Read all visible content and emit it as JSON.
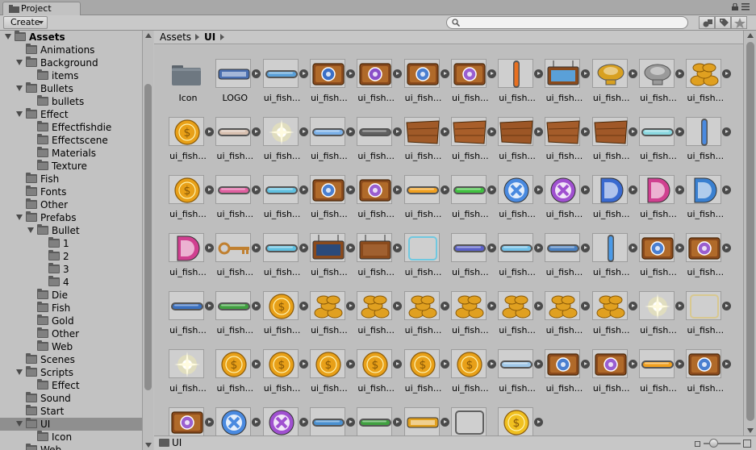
{
  "window": {
    "tab_title": "Project"
  },
  "toolbar": {
    "create_label": "Create",
    "search_value": "",
    "search_placeholder": ""
  },
  "breadcrumb": [
    "Assets",
    "UI"
  ],
  "tree": [
    {
      "label": "Assets",
      "depth": 0,
      "expanded": true,
      "bold": true
    },
    {
      "label": "Animations",
      "depth": 1,
      "expanded": null
    },
    {
      "label": "Background",
      "depth": 1,
      "expanded": true
    },
    {
      "label": "items",
      "depth": 2,
      "expanded": null
    },
    {
      "label": "Bullets",
      "depth": 1,
      "expanded": true
    },
    {
      "label": "bullets",
      "depth": 2,
      "expanded": null
    },
    {
      "label": "Effect",
      "depth": 1,
      "expanded": true
    },
    {
      "label": "Effectfishdie",
      "depth": 2,
      "expanded": null
    },
    {
      "label": "Effectscene",
      "depth": 2,
      "expanded": null
    },
    {
      "label": "Materials",
      "depth": 2,
      "expanded": null
    },
    {
      "label": "Texture",
      "depth": 2,
      "expanded": null
    },
    {
      "label": "Fish",
      "depth": 1,
      "expanded": null
    },
    {
      "label": "Fonts",
      "depth": 1,
      "expanded": null
    },
    {
      "label": "Other",
      "depth": 1,
      "expanded": null
    },
    {
      "label": "Prefabs",
      "depth": 1,
      "expanded": true
    },
    {
      "label": "Bullet",
      "depth": 2,
      "expanded": true
    },
    {
      "label": "1",
      "depth": 3,
      "expanded": null
    },
    {
      "label": "2",
      "depth": 3,
      "expanded": null
    },
    {
      "label": "3",
      "depth": 3,
      "expanded": null
    },
    {
      "label": "4",
      "depth": 3,
      "expanded": null
    },
    {
      "label": "Die",
      "depth": 2,
      "expanded": null
    },
    {
      "label": "Fish",
      "depth": 2,
      "expanded": null
    },
    {
      "label": "Gold",
      "depth": 2,
      "expanded": null
    },
    {
      "label": "Other",
      "depth": 2,
      "expanded": null
    },
    {
      "label": "Web",
      "depth": 2,
      "expanded": null
    },
    {
      "label": "Scenes",
      "depth": 1,
      "expanded": null
    },
    {
      "label": "Scripts",
      "depth": 1,
      "expanded": true
    },
    {
      "label": "Effect",
      "depth": 2,
      "expanded": null
    },
    {
      "label": "Sound",
      "depth": 1,
      "expanded": null
    },
    {
      "label": "Start",
      "depth": 1,
      "expanded": null
    },
    {
      "label": "UI",
      "depth": 1,
      "expanded": true,
      "selected": true
    },
    {
      "label": "Icon",
      "depth": 2,
      "expanded": null
    },
    {
      "label": "Web",
      "depth": 1,
      "expanded": null
    }
  ],
  "assets": [
    {
      "name": "Icon",
      "kind": "folder",
      "expandable": false
    },
    {
      "name": "LOGO",
      "kind": "logo",
      "color": "#4a6fb0",
      "expandable": true
    },
    {
      "name": "ui_fish...",
      "kind": "bar",
      "color": "#5aa0d8",
      "expandable": true
    },
    {
      "name": "ui_fish...",
      "kind": "plaque",
      "color": "#3b6fc6",
      "expandable": true
    },
    {
      "name": "ui_fish...",
      "kind": "plaque",
      "color": "#8a4fc8",
      "expandable": true
    },
    {
      "name": "ui_fish...",
      "kind": "plaque",
      "color": "#4a7fd0",
      "expandable": true
    },
    {
      "name": "ui_fish...",
      "kind": "plaque",
      "color": "#9a5fd0",
      "expandable": true
    },
    {
      "name": "ui_fish...",
      "kind": "vbar",
      "color": "#e87020",
      "expandable": true
    },
    {
      "name": "ui_fish...",
      "kind": "sign",
      "color": "#5aa0d8",
      "expandable": true
    },
    {
      "name": "ui_fish...",
      "kind": "trophy",
      "color": "#d8a020",
      "expandable": true
    },
    {
      "name": "ui_fish...",
      "kind": "trophy",
      "color": "#9a9a9a",
      "expandable": true
    },
    {
      "name": "ui_fish...",
      "kind": "coins",
      "color": "#e0a020",
      "expandable": true
    },
    {
      "name": "ui_fish...",
      "kind": "coin",
      "color": "#e8a018",
      "expandable": true
    },
    {
      "name": "ui_fish...",
      "kind": "bar",
      "color": "#d8c0b0",
      "expandable": true
    },
    {
      "name": "ui_fish...",
      "kind": "glow",
      "color": "#fff6a0",
      "expandable": true
    },
    {
      "name": "ui_fish...",
      "kind": "bar",
      "color": "#7ab0e8",
      "expandable": true
    },
    {
      "name": "ui_fish...",
      "kind": "bar",
      "color": "#606060",
      "expandable": true
    },
    {
      "name": "ui_fish...",
      "kind": "wood",
      "color": "#a05a28",
      "expandable": true
    },
    {
      "name": "ui_fish...",
      "kind": "wood",
      "color": "#a85e2a",
      "expandable": true
    },
    {
      "name": "ui_fish...",
      "kind": "wood",
      "color": "#9c5626",
      "expandable": true
    },
    {
      "name": "ui_fish...",
      "kind": "wood",
      "color": "#a45c2a",
      "expandable": true
    },
    {
      "name": "ui_fish...",
      "kind": "wood",
      "color": "#a05828",
      "expandable": true
    },
    {
      "name": "ui_fish...",
      "kind": "bar",
      "color": "#8ad8e0",
      "expandable": true
    },
    {
      "name": "ui_fish...",
      "kind": "vbar",
      "color": "#4a8ae0",
      "expandable": true
    },
    {
      "name": "ui_fish...",
      "kind": "coin",
      "color": "#e8a018",
      "expandable": true
    },
    {
      "name": "ui_fish...",
      "kind": "bar",
      "color": "#e060a0",
      "expandable": true
    },
    {
      "name": "ui_fish...",
      "kind": "bar",
      "color": "#60c0e0",
      "expandable": true
    },
    {
      "name": "ui_fish...",
      "kind": "plaque",
      "color": "#4a7fd0",
      "expandable": true
    },
    {
      "name": "ui_fish...",
      "kind": "plaque",
      "color": "#9a5fd0",
      "expandable": true
    },
    {
      "name": "ui_fish...",
      "kind": "bar",
      "color": "#f0a020",
      "expandable": true
    },
    {
      "name": "ui_fish...",
      "kind": "bar",
      "color": "#40c040",
      "expandable": true
    },
    {
      "name": "ui_fish...",
      "kind": "xbtn",
      "color": "#4a8ae0",
      "expandable": true
    },
    {
      "name": "ui_fish...",
      "kind": "xbtn",
      "color": "#a050d0",
      "expandable": true
    },
    {
      "name": "ui_fish...",
      "kind": "dbtn",
      "color": "#3a6ad0",
      "expandable": true
    },
    {
      "name": "ui_fish...",
      "kind": "dbtn",
      "color": "#d04090",
      "expandable": true
    },
    {
      "name": "ui_fish...",
      "kind": "dbtn",
      "color": "#3a80d0",
      "expandable": true
    },
    {
      "name": "ui_fish...",
      "kind": "dbtn",
      "color": "#d04090",
      "expandable": true
    },
    {
      "name": "ui_fish...",
      "kind": "key",
      "color": "#c08030",
      "expandable": true
    },
    {
      "name": "ui_fish...",
      "kind": "bar",
      "color": "#60c0e0",
      "expandable": true
    },
    {
      "name": "ui_fish...",
      "kind": "sign",
      "color": "#2a4a7a",
      "expandable": true
    },
    {
      "name": "ui_fish...",
      "kind": "sign",
      "color": "#a06030",
      "expandable": true
    },
    {
      "name": "ui_fish...",
      "kind": "frame",
      "color": "#70c8e0",
      "expandable": false
    },
    {
      "name": "ui_fish...",
      "kind": "bar",
      "color": "#5a60c8",
      "expandable": true
    },
    {
      "name": "ui_fish...",
      "kind": "bar",
      "color": "#70c0e8",
      "expandable": true
    },
    {
      "name": "ui_fish...",
      "kind": "bar",
      "color": "#4a80c0",
      "expandable": true
    },
    {
      "name": "ui_fish...",
      "kind": "vbar",
      "color": "#4a9ae8",
      "expandable": true
    },
    {
      "name": "ui_fish...",
      "kind": "plaque",
      "color": "#4a7fd0",
      "expandable": true
    },
    {
      "name": "ui_fish...",
      "kind": "plaque",
      "color": "#9a5fd0",
      "expandable": true
    },
    {
      "name": "ui_fish...",
      "kind": "bar",
      "color": "#3a70c0",
      "expandable": true
    },
    {
      "name": "ui_fish...",
      "kind": "bar",
      "color": "#40a040",
      "expandable": true
    },
    {
      "name": "ui_fish...",
      "kind": "coin",
      "color": "#e8a018",
      "expandable": true
    },
    {
      "name": "ui_fish...",
      "kind": "coins",
      "color": "#e0a020",
      "expandable": true
    },
    {
      "name": "ui_fish...",
      "kind": "coins",
      "color": "#e0a020",
      "expandable": true
    },
    {
      "name": "ui_fish...",
      "kind": "coins",
      "color": "#e0a020",
      "expandable": true
    },
    {
      "name": "ui_fish...",
      "kind": "coins",
      "color": "#e0a020",
      "expandable": true
    },
    {
      "name": "ui_fish...",
      "kind": "coins",
      "color": "#e0a020",
      "expandable": true
    },
    {
      "name": "ui_fish...",
      "kind": "coins",
      "color": "#e0a020",
      "expandable": true
    },
    {
      "name": "ui_fish...",
      "kind": "coins",
      "color": "#e0a020",
      "expandable": true
    },
    {
      "name": "ui_fish...",
      "kind": "glow",
      "color": "#fff6a0",
      "expandable": true
    },
    {
      "name": "ui_fish...",
      "kind": "frame",
      "color": "#d8c890",
      "expandable": true
    },
    {
      "name": "ui_fish...",
      "kind": "glow",
      "color": "#fff6a0",
      "expandable": false
    },
    {
      "name": "ui_fish...",
      "kind": "coin",
      "color": "#e8a018",
      "expandable": true
    },
    {
      "name": "ui_fish...",
      "kind": "coin",
      "color": "#e8a018",
      "expandable": true
    },
    {
      "name": "ui_fish...",
      "kind": "coin",
      "color": "#e8a018",
      "expandable": true
    },
    {
      "name": "ui_fish...",
      "kind": "coin",
      "color": "#e8a018",
      "expandable": true
    },
    {
      "name": "ui_fish...",
      "kind": "coin",
      "color": "#e8a018",
      "expandable": true
    },
    {
      "name": "ui_fish...",
      "kind": "coin",
      "color": "#e8a018",
      "expandable": true
    },
    {
      "name": "ui_fish...",
      "kind": "bar",
      "color": "#a0c8e8",
      "expandable": true
    },
    {
      "name": "ui_fish...",
      "kind": "plaque",
      "color": "#4a7fd0",
      "expandable": true
    },
    {
      "name": "ui_fish...",
      "kind": "plaque",
      "color": "#9a5fd0",
      "expandable": true
    },
    {
      "name": "ui_fish...",
      "kind": "bar",
      "color": "#f0a020",
      "expandable": true
    },
    {
      "name": "ui_fish...",
      "kind": "plaque",
      "color": "#4a7fd0",
      "expandable": true
    },
    {
      "name": "",
      "kind": "plaque",
      "color": "#9a5fd0",
      "expandable": true
    },
    {
      "name": "",
      "kind": "xbtn",
      "color": "#4a8ae0",
      "expandable": true
    },
    {
      "name": "",
      "kind": "xbtn",
      "color": "#a050d0",
      "expandable": true
    },
    {
      "name": "",
      "kind": "bar",
      "color": "#4a90d0",
      "expandable": true
    },
    {
      "name": "",
      "kind": "bar",
      "color": "#40a040",
      "expandable": true
    },
    {
      "name": "",
      "kind": "logo",
      "color": "#e0a020",
      "expandable": true
    },
    {
      "name": "",
      "kind": "frame",
      "color": "#606060",
      "expandable": false
    },
    {
      "name": "",
      "kind": "coin",
      "color": "#f0c020",
      "expandable": true
    }
  ],
  "status": {
    "path": "UI"
  }
}
